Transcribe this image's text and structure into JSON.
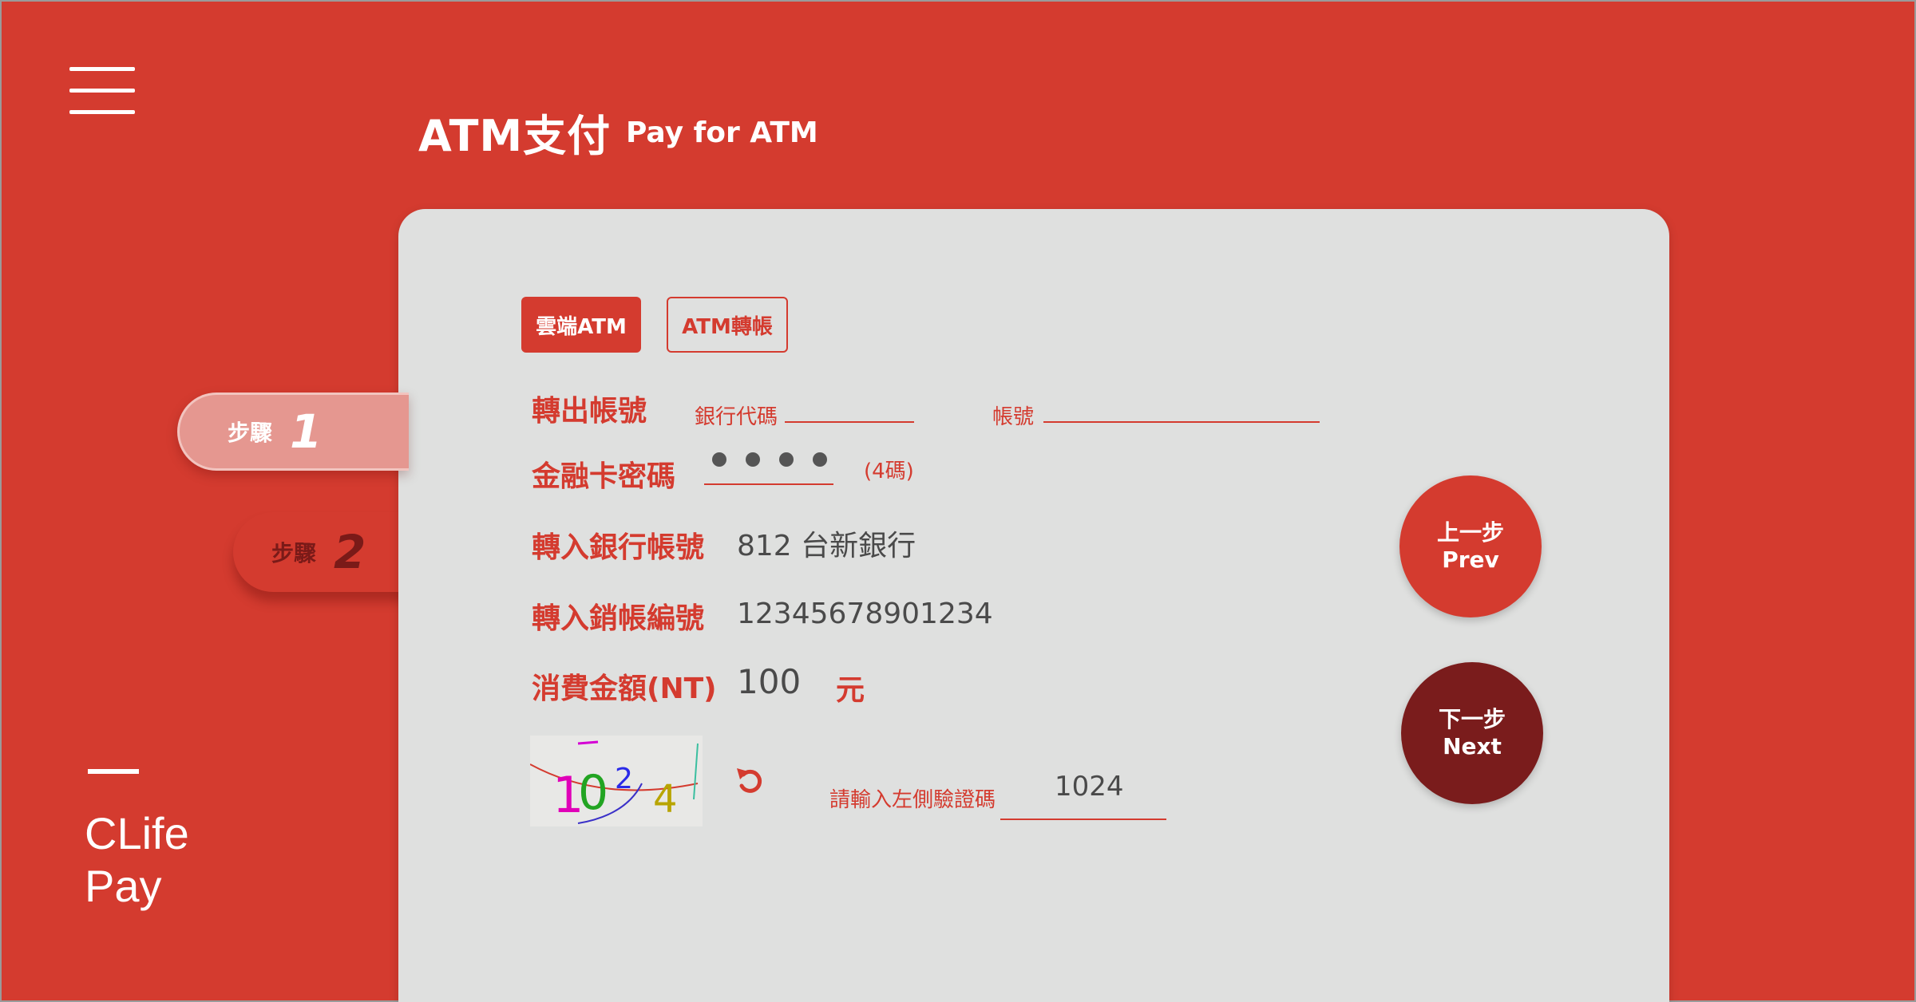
{
  "header": {
    "title": "ATM支付",
    "subtitle": "Pay for ATM"
  },
  "brand": {
    "name": "CLife\nPay"
  },
  "steps": [
    {
      "label": "步驟",
      "number": "1"
    },
    {
      "label": "步驟",
      "number": "2"
    }
  ],
  "tabs": {
    "cloud_atm": "雲端ATM",
    "atm_transfer": "ATM轉帳"
  },
  "form": {
    "out_account_label": "轉出帳號",
    "bank_code_label": "銀行代碼",
    "bank_code_value": "",
    "account_no_label": "帳號",
    "account_no_value": "",
    "pin_label": "金融卡密碼",
    "pin_hint": "(4碼)",
    "in_bank_label": "轉入銀行帳號",
    "in_bank_value": "812 台新銀行",
    "in_account_label": "轉入銷帳編號",
    "in_account_value": "12345678901234",
    "amount_label": "消費金額(NT)",
    "amount_value": "100",
    "amount_unit": "元",
    "captcha_text": "1024",
    "captcha_input_label": "請輸入左側驗證碼",
    "captcha_input_value": "1024"
  },
  "buttons": {
    "prev_zh": "上一步",
    "prev_en": "Prev",
    "next_zh": "下一步",
    "next_en": "Next"
  },
  "colors": {
    "primary": "#d43b2f",
    "dark": "#7a1c1c",
    "card": "#dfe0df"
  }
}
